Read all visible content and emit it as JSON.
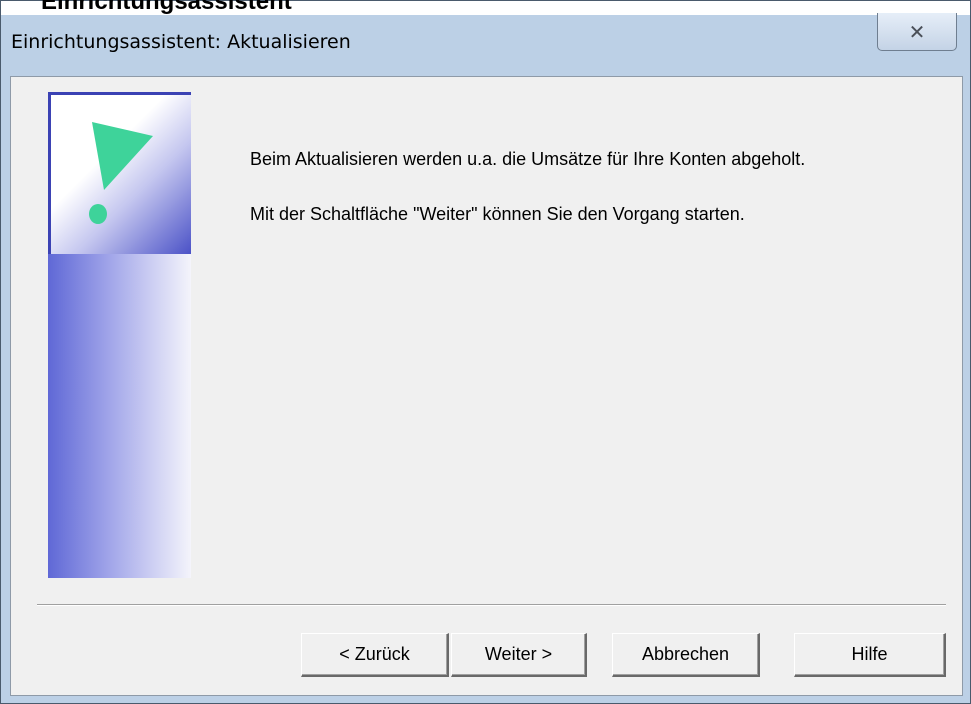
{
  "window": {
    "clipped_title": "Einrichtungsassistent",
    "title": "Einrichtungsassistent: Aktualisieren",
    "close_glyph": "✕"
  },
  "content": {
    "line1": "Beim Aktualisieren werden u.a. die Umsätze für Ihre Konten abgeholt.",
    "line2": "Mit der Schaltfläche \"Weiter\" können Sie den Vorgang starten."
  },
  "buttons": {
    "back": "< Zurück",
    "next": "Weiter >",
    "cancel": "Abbrechen",
    "help": "Hilfe"
  },
  "icons": {
    "graphic": "exclamation-icon",
    "close": "close-icon"
  },
  "colors": {
    "exclamation": "#3ed39a",
    "graphic_blue": "#4a52c8"
  }
}
